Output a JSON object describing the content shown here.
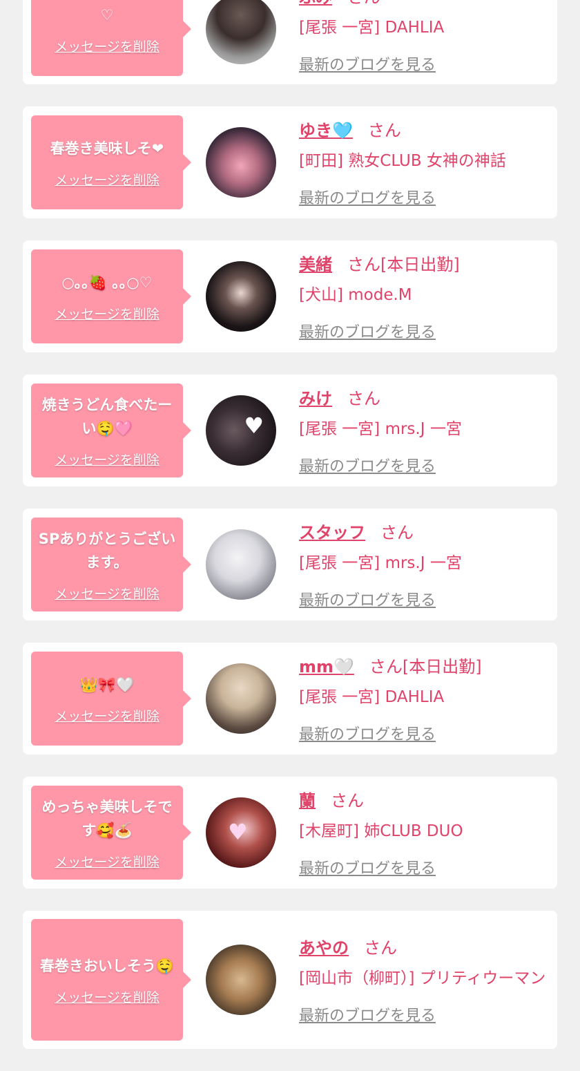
{
  "delete_label": "メッセージを削除",
  "san_label": "さん",
  "blog_label": "最新のブログを見る",
  "entries": [
    {
      "message": "♡",
      "name": "ふみ",
      "suffix": "",
      "shop": "[尾張 一宮] DAHLIA"
    },
    {
      "message": "春巻き美味しそ❤",
      "name": "ゆき🩵",
      "suffix": "",
      "shop": "[町田] 熟女CLUB 女神の神話"
    },
    {
      "message": "○｡｡🍓 ｡｡○♡",
      "name": "美緒",
      "suffix": "[本日出勤]",
      "shop": "[犬山] mode.M"
    },
    {
      "message": "焼きうどん食べたーい🤤🩷",
      "name": "みけ",
      "suffix": "",
      "shop": "[尾張 一宮] mrs.J 一宮"
    },
    {
      "message": "SPありがとうございます。",
      "name": "スタッフ",
      "suffix": "",
      "shop": "[尾張 一宮] mrs.J 一宮"
    },
    {
      "message": "👑🎀🤍",
      "name": "mm🤍",
      "suffix": "[本日出勤]",
      "shop": "[尾張 一宮] DAHLIA"
    },
    {
      "message": "めっちゃ美味しそです🥰🍝",
      "name": "蘭",
      "suffix": "",
      "shop": "[木屋町] 姉CLUB DUO"
    },
    {
      "message": "春巻きおいしそう🤤",
      "name": "あやの",
      "suffix": "",
      "shop": "[岡山市（柳町）] プリティウーマン"
    }
  ],
  "colors": {
    "accent": "#e0436a",
    "bubble": "#ff97a9",
    "background": "#f0f0f0",
    "card": "#ffffff",
    "link_gray": "#8a8a8a"
  }
}
